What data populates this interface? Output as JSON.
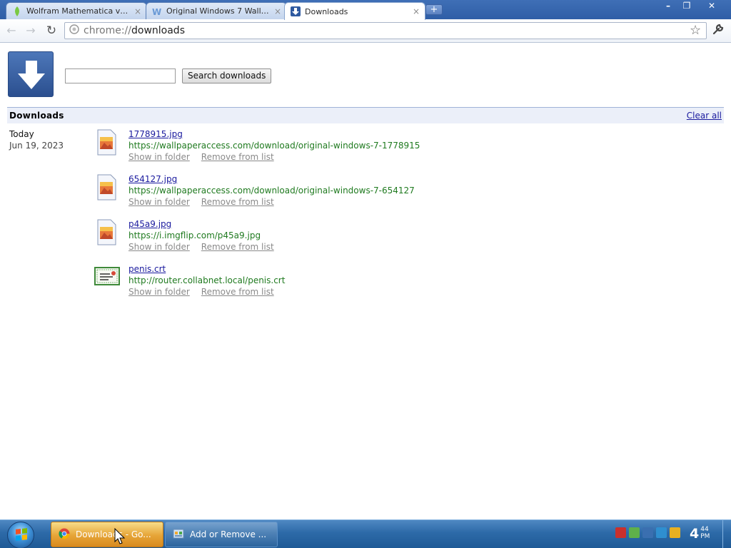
{
  "browser": {
    "tabs": [
      {
        "title": "Wolfram Mathematica v13....",
        "favicon": "wolfram-leaf-icon",
        "close": "×"
      },
      {
        "title": "Original Windows 7 Wallpa...",
        "favicon": "wallpaper-access-w-icon",
        "close": "×"
      },
      {
        "title": "Downloads",
        "favicon": "downloads-arrow-icon",
        "close": "×",
        "active": true
      }
    ],
    "new_tab": "+",
    "window_controls": {
      "minimize": "–",
      "restore": "❐",
      "close": "✕"
    },
    "toolbar": {
      "back": "←",
      "forward": "→",
      "reload": "↻",
      "url_scheme": "chrome://",
      "url_host": "downloads",
      "star": "☆",
      "wrench": "🔧"
    }
  },
  "downloads_page": {
    "search_placeholder": "",
    "search_button": "Search downloads",
    "section_title": "Downloads",
    "clear_all": "Clear all",
    "date_label": "Today",
    "date_full": "Jun 19, 2023",
    "items": [
      {
        "name": "1778915.jpg",
        "url": "https://wallpaperaccess.com/download/original-windows-7-1778915",
        "show": "Show in folder",
        "remove": "Remove from list",
        "icon": "image-file-icon"
      },
      {
        "name": "654127.jpg",
        "url": "https://wallpaperaccess.com/download/original-windows-7-654127",
        "show": "Show in folder",
        "remove": "Remove from list",
        "icon": "image-file-icon"
      },
      {
        "name": "p45a9.jpg",
        "url": "https://i.imgflip.com/p45a9.jpg",
        "show": "Show in folder",
        "remove": "Remove from list",
        "icon": "image-file-icon"
      },
      {
        "name": "penis.crt",
        "url": "http://router.collabnet.local/penis.crt",
        "show": "Show in folder",
        "remove": "Remove from list",
        "icon": "certificate-file-icon"
      }
    ]
  },
  "taskbar": {
    "buttons": [
      {
        "label": "Downloads - Go...",
        "icon": "chrome-icon",
        "active": true
      },
      {
        "label": "Add or Remove ...",
        "icon": "control-panel-icon",
        "active": false
      }
    ],
    "clock": {
      "hour": "4",
      "minute": "44",
      "ampm": "PM"
    }
  },
  "colors": {
    "link": "#1a1a9e",
    "url_green": "#1f7a1f",
    "action_gray": "#8a8a8a",
    "section_bg": "#ebeff9",
    "task_active": "#e6a437"
  }
}
